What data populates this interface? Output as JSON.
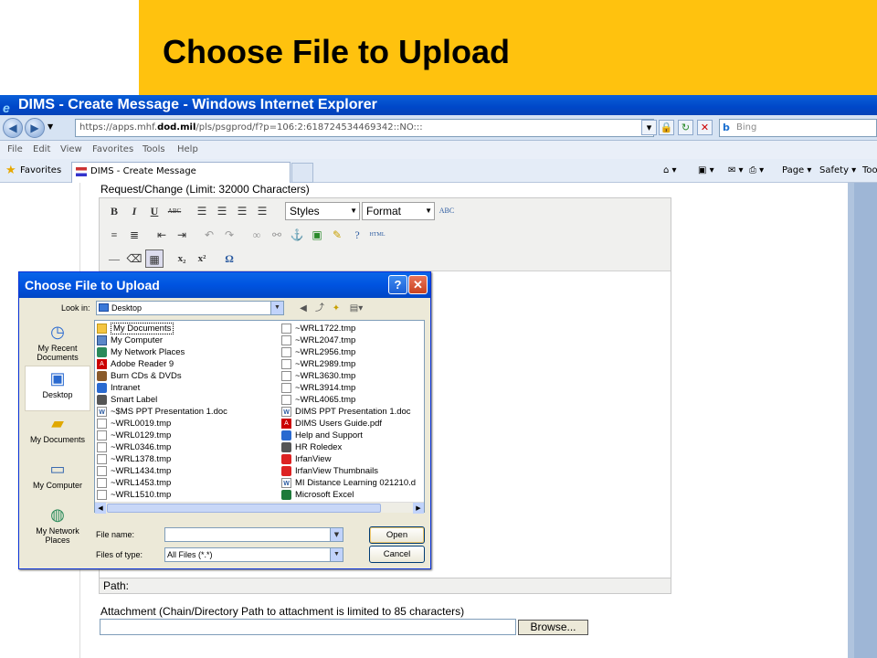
{
  "slide": {
    "title": "Choose File to Upload"
  },
  "browser": {
    "title": "DIMS - Create Message - Windows Internet Explorer",
    "url_prefix": "https://apps.mhf.",
    "url_domain": "dod.mil",
    "url_path": "/pls/psgprod/f?p=106:2:618724534469342::NO:::",
    "search_placeholder": "Bing",
    "search_logo": "b",
    "menu": [
      "File",
      "Edit",
      "View",
      "Favorites",
      "Tools",
      "Help"
    ],
    "favorites_label": "Favorites",
    "tab_title": "DIMS - Create Message",
    "commands": [
      "Page ▾",
      "Safety ▾",
      "Too"
    ]
  },
  "form": {
    "request_label": "Request/Change (Limit: 32000 Characters)",
    "styles_select": "Styles",
    "format_select": "Format",
    "path_label": "Path:",
    "attachment_label": "Attachment (Chain/Directory Path to attachment is limited to 85 characters)",
    "browse_button": "Browse..."
  },
  "dialog": {
    "title": "Choose File to Upload",
    "look_in_label": "Look in:",
    "look_in_value": "Desktop",
    "places": [
      {
        "label": "My Recent Documents",
        "icon": "recent-documents-icon"
      },
      {
        "label": "Desktop",
        "icon": "desktop-icon",
        "selected": true
      },
      {
        "label": "My Documents",
        "icon": "my-documents-icon"
      },
      {
        "label": "My Computer",
        "icon": "my-computer-icon"
      },
      {
        "label": "My Network Places",
        "icon": "network-places-icon"
      }
    ],
    "files_col1": [
      {
        "name": "My Documents",
        "icon": "folder-icon"
      },
      {
        "name": "My Computer",
        "icon": "computer-icon"
      },
      {
        "name": "My Network Places",
        "icon": "network-icon"
      },
      {
        "name": "Adobe Reader 9",
        "icon": "pdf-icon"
      },
      {
        "name": "Burn CDs & DVDs",
        "icon": "cd-icon"
      },
      {
        "name": "Intranet",
        "icon": "globe-icon"
      },
      {
        "name": "Smart Label",
        "icon": "label-icon"
      },
      {
        "name": "~$MS PPT Presentation 1.doc",
        "icon": "doc-icon"
      },
      {
        "name": "~WRL0019.tmp",
        "icon": "file-icon"
      },
      {
        "name": "~WRL0129.tmp",
        "icon": "file-icon"
      },
      {
        "name": "~WRL0346.tmp",
        "icon": "file-icon"
      },
      {
        "name": "~WRL1378.tmp",
        "icon": "file-icon"
      },
      {
        "name": "~WRL1434.tmp",
        "icon": "file-icon"
      },
      {
        "name": "~WRL1453.tmp",
        "icon": "file-icon"
      },
      {
        "name": "~WRL1510.tmp",
        "icon": "file-icon"
      }
    ],
    "files_col2": [
      {
        "name": "~WRL1722.tmp",
        "icon": "file-icon"
      },
      {
        "name": "~WRL2047.tmp",
        "icon": "file-icon"
      },
      {
        "name": "~WRL2956.tmp",
        "icon": "file-icon"
      },
      {
        "name": "~WRL2989.tmp",
        "icon": "file-icon"
      },
      {
        "name": "~WRL3630.tmp",
        "icon": "file-icon"
      },
      {
        "name": "~WRL3914.tmp",
        "icon": "file-icon"
      },
      {
        "name": "~WRL4065.tmp",
        "icon": "file-icon"
      },
      {
        "name": "DIMS PPT Presentation 1.doc",
        "icon": "doc-icon"
      },
      {
        "name": "DIMS Users Guide.pdf",
        "icon": "pdf-icon"
      },
      {
        "name": "Help and Support",
        "icon": "help-icon"
      },
      {
        "name": "HR Roledex",
        "icon": "rolodex-icon"
      },
      {
        "name": "IrfanView",
        "icon": "irfanview-icon"
      },
      {
        "name": "IrfanView Thumbnails",
        "icon": "irfanview-icon"
      },
      {
        "name": "MI Distance Learning 021210.d",
        "icon": "doc-icon"
      },
      {
        "name": "Microsoft Excel",
        "icon": "excel-icon"
      }
    ],
    "file_name_label": "File name:",
    "file_name_value": "",
    "files_of_type_label": "Files of type:",
    "files_of_type_value": "All Files (*.*)",
    "open_button": "Open",
    "cancel_button": "Cancel",
    "help_button": "?",
    "close_button": "✕"
  }
}
